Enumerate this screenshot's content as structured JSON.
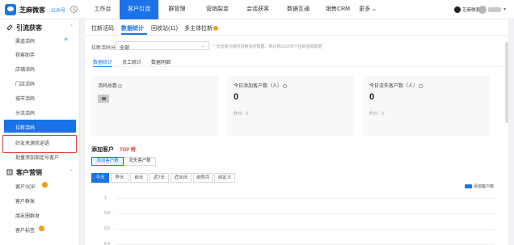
{
  "topbar": {
    "brand": "芝麻微客",
    "brand_tag": "公众号",
    "nav": [
      {
        "label": "工作台"
      },
      {
        "label": "客户引流"
      },
      {
        "label": "群管理"
      },
      {
        "label": "营销裂变"
      },
      {
        "label": "会话获客"
      },
      {
        "label": "数据互通"
      },
      {
        "label": "销售CRM"
      },
      {
        "label": "更多 ⌄"
      }
    ],
    "active_nav": "客户引流",
    "user_name": "芝麻微客"
  },
  "sidebar": {
    "group1": "引流获客",
    "items1": [
      {
        "label": "渠道活码"
      },
      {
        "label": "获客助手"
      },
      {
        "label": "店铺活码"
      },
      {
        "label": "门店活码"
      },
      {
        "label": "城市活码"
      },
      {
        "label": "分流活码"
      },
      {
        "label": "拉新活码"
      },
      {
        "label": "好友来源欢迎语"
      },
      {
        "label": "批量添加指定号客户"
      }
    ],
    "active_item": "拉新活码",
    "group2": "客户营销",
    "items2": [
      {
        "label": "客户SOP"
      },
      {
        "label": "客户群发"
      },
      {
        "label": "朋友圈群发"
      },
      {
        "label": "客户标签"
      }
    ]
  },
  "main": {
    "tabs": [
      {
        "label": "拉新活码"
      },
      {
        "label": "数据统计"
      },
      {
        "label": "回收站(11)"
      },
      {
        "label": "多主体拉新"
      }
    ],
    "active_tab": "数据统计",
    "filter": {
      "label": "拉新活码分组:",
      "value": "全部",
      "hint": "* 无选择分组时切换实时数据，统计将以1000个拉新活码数据"
    },
    "subtabs": [
      {
        "label": "数据统计"
      },
      {
        "label": "员工统计"
      },
      {
        "label": "数据明细"
      }
    ],
    "stats": [
      {
        "title": "活码总数",
        "value": "",
        "sub": ""
      },
      {
        "title": "今日添加客户数（人）",
        "value": "0",
        "sub": "昨日：0"
      },
      {
        "title": "今日流失客户数（人）",
        "value": "0",
        "sub": "昨日：0"
      }
    ],
    "add_section": {
      "title": "添加客户",
      "badge": "TOP 榜",
      "segments": [
        {
          "label": "添加客户数"
        },
        {
          "label": "流失客户数"
        }
      ],
      "date_buttons": [
        {
          "label": "今天"
        },
        {
          "label": "昨天"
        },
        {
          "label": "前天"
        },
        {
          "label": "近7天"
        },
        {
          "label": "近30天"
        },
        {
          "label": "自然月"
        },
        {
          "label": "自定义"
        }
      ]
    }
  },
  "chart_data": {
    "type": "line",
    "series": [
      {
        "name": "添加客户数",
        "values": []
      }
    ],
    "y_ticks": [
      "1",
      "0.8",
      "0.6",
      "0.4"
    ],
    "legend": "top-right",
    "colors": {
      "series": "#1a73e8"
    }
  }
}
